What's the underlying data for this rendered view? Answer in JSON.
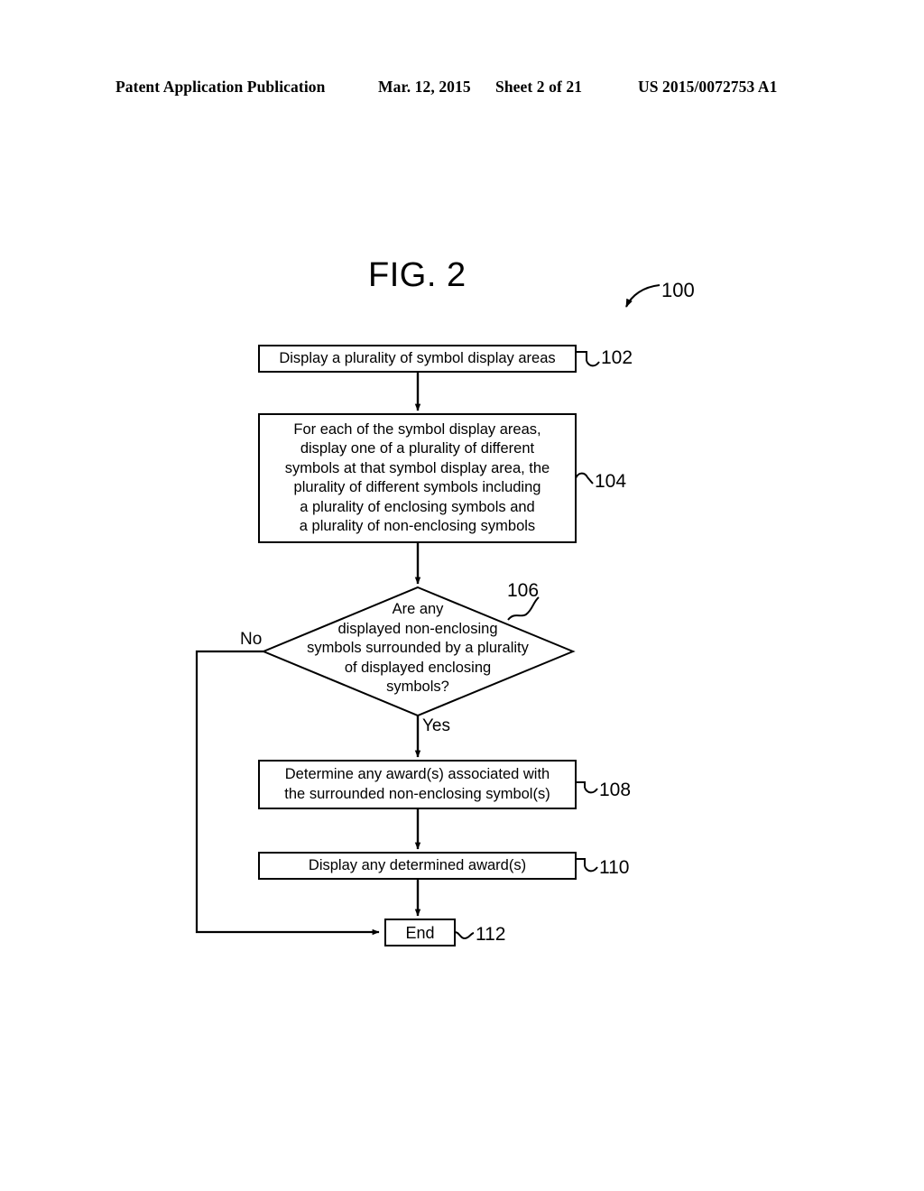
{
  "header": {
    "publication": "Patent Application Publication",
    "date": "Mar. 12, 2015",
    "sheet": "Sheet 2 of 21",
    "patent_number": "US 2015/0072753 A1"
  },
  "figure": {
    "title": "FIG. 2",
    "diagram_ref": "100"
  },
  "flowchart": {
    "nodes": [
      {
        "id": "102",
        "type": "process",
        "ref": "102",
        "text": "Display a plurality of symbol display areas"
      },
      {
        "id": "104",
        "type": "process",
        "ref": "104",
        "text": "For each of the symbol display areas,\ndisplay one of a plurality of different\nsymbols at that symbol display area, the\nplurality of different symbols including\na plurality of enclosing symbols and\na plurality of non-enclosing symbols"
      },
      {
        "id": "106",
        "type": "decision",
        "ref": "106",
        "text": "Are any\ndisplayed non-enclosing\nsymbols surrounded by a plurality\nof displayed enclosing\nsymbols?"
      },
      {
        "id": "108",
        "type": "process",
        "ref": "108",
        "text": "Determine any award(s) associated with\nthe surrounded non-enclosing symbol(s)"
      },
      {
        "id": "110",
        "type": "process",
        "ref": "110",
        "text": "Display any determined award(s)"
      },
      {
        "id": "112",
        "type": "terminator",
        "ref": "112",
        "text": "End"
      }
    ],
    "branch_labels": {
      "no": "No",
      "yes": "Yes"
    }
  },
  "colors": {
    "ink": "#000000",
    "paper": "#ffffff"
  }
}
